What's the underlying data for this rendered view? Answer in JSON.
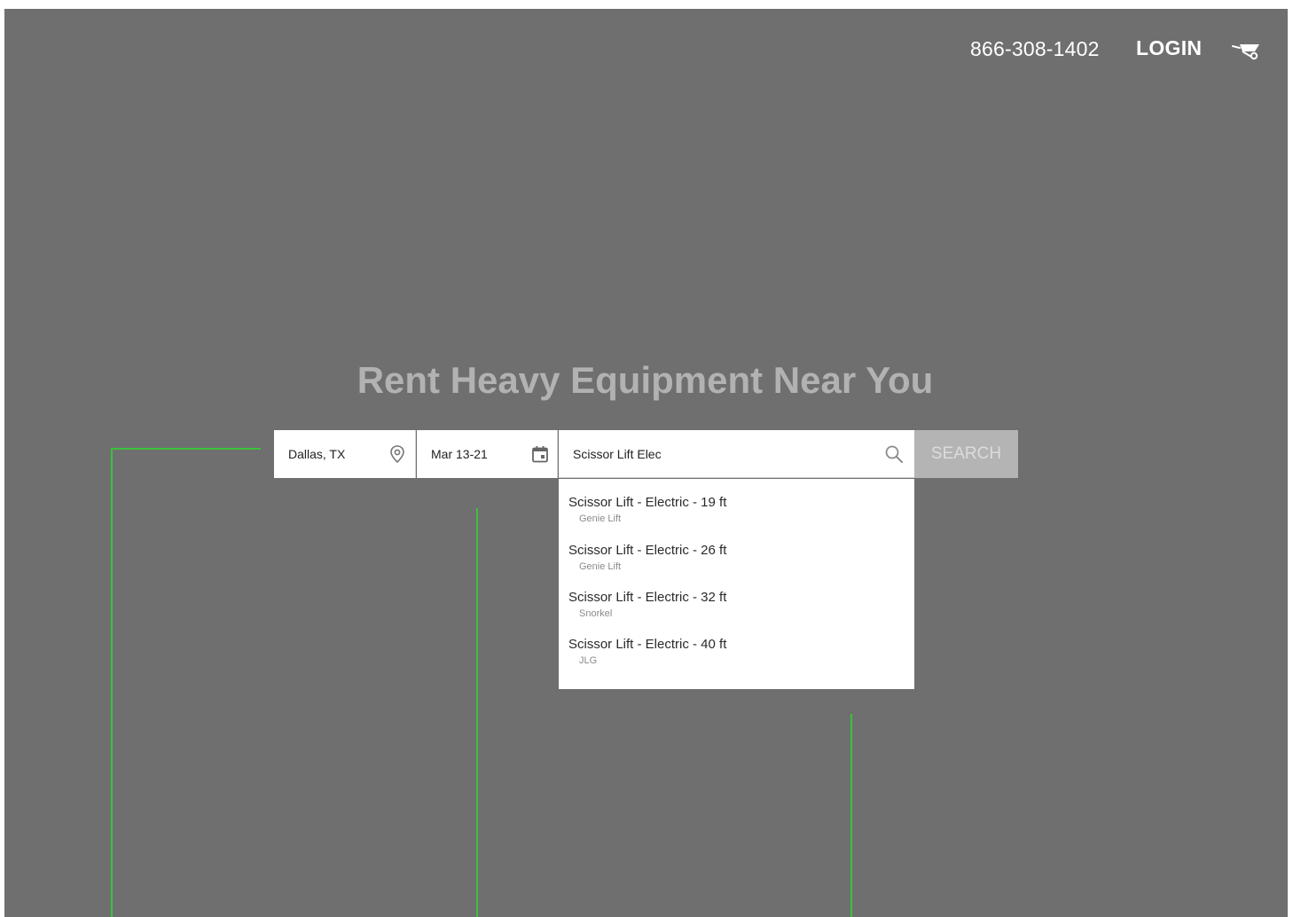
{
  "header": {
    "phone": "866-308-1402",
    "login_label": "LOGIN",
    "cart_icon": "wheelbarrow-cart-icon"
  },
  "hero": {
    "title": "Rent Heavy Equipment Near You"
  },
  "search": {
    "location_value": "Dallas, TX",
    "location_icon": "location-pin-icon",
    "dates_value": "Mar 13-21",
    "dates_icon": "calendar-icon",
    "query_value": "Scissor Lift Elec",
    "query_icon": "search-icon",
    "button_label": "SEARCH"
  },
  "suggestions": [
    {
      "name": "Scissor Lift - Electric - 19 ft",
      "brand": "Genie Lift"
    },
    {
      "name": "Scissor Lift - Electric - 26 ft",
      "brand": "Genie Lift"
    },
    {
      "name": "Scissor Lift - Electric - 32 ft",
      "brand": "Snorkel"
    },
    {
      "name": "Scissor Lift - Electric - 40 ft",
      "brand": "JLG"
    }
  ],
  "colors": {
    "background": "#6f6f6f",
    "annotation_line": "#3cc13c",
    "hero_text": "#b2b2b2",
    "button_bg": "#b4b4b4"
  }
}
